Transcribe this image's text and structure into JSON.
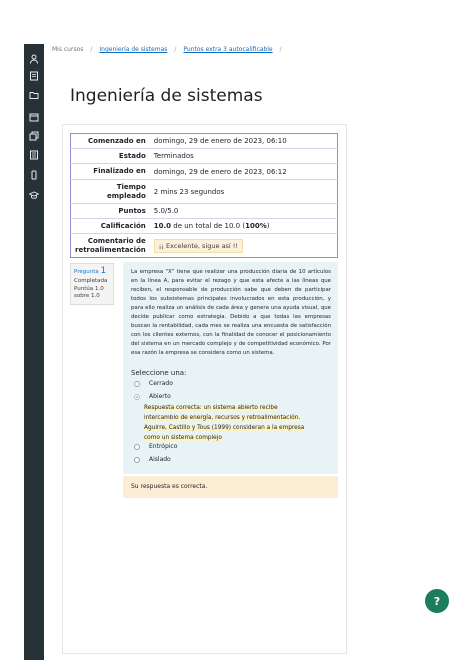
{
  "breadcrumb": {
    "home": "Mis cursos",
    "course": "Ingeniería de sistemas",
    "quiz": "Puntos extra 3 autocalificable"
  },
  "page_title": "Ingeniería de sistemas",
  "summary": {
    "started_label": "Comenzado en",
    "started_value": "domingo, 29 de enero de 2023, 06:10",
    "state_label": "Estado",
    "state_value": "Terminados",
    "finished_label": "Finalizado en",
    "finished_value": "domingo, 29 de enero de 2023, 06:12",
    "time_label_1": "Tiempo",
    "time_label_2": "empleado",
    "time_value": "2 mins 23 segundos",
    "points_label": "Puntos",
    "points_value": "5.0/5.0",
    "grade_label": "Calificación",
    "grade_bold": "10.0",
    "grade_mid": " de un total de 10.0 (",
    "grade_pct": "100%",
    "grade_end": ")",
    "feedback_label_1": "Comentario de",
    "feedback_label_2": "retroalimentación",
    "feedback_value": "¡¡ Excelente, sigue así !!"
  },
  "question_info": {
    "label": "Pregunta",
    "number": "1",
    "status": "Completada",
    "score_line1": "Puntúa 1.0",
    "score_line2": "sobre 1.0"
  },
  "question": {
    "text": "La empresa “X” tiene que realizar una producción diaria de 10 artículos en la línea A, para evitar el rezago y que esta afecte a las líneas que reciben, el responsable de producción sabe que deben de participar todos los subsistemas principales involucrados en esta producción, y para ello realiza un análisis de cada área y genera una ayuda visual, que decide publicar como estrategia. Debido a que todas las empresas buscan la rentabilidad, cada mes se realiza una encuesta de satisfacción con los clientes externos, con la finalidad de conocer el posicionamiento del sistema en un mercado complejo y de competitividad económico. Por esa razón la empresa se considera como un sistema.",
    "prompt": "Seleccione una:",
    "options": [
      "Cerrado",
      "Abierto",
      "Entrópico",
      "Aislado"
    ],
    "explanation": "Respuesta correcta: un sistema abierto recibe intercambio de energía, recursos y retroalimentación. Aguirre, Castillo y Tous (1999) consideran a la empresa como un sistema complejo"
  },
  "result": "Su respuesta es correcta.",
  "help_label": "?"
}
